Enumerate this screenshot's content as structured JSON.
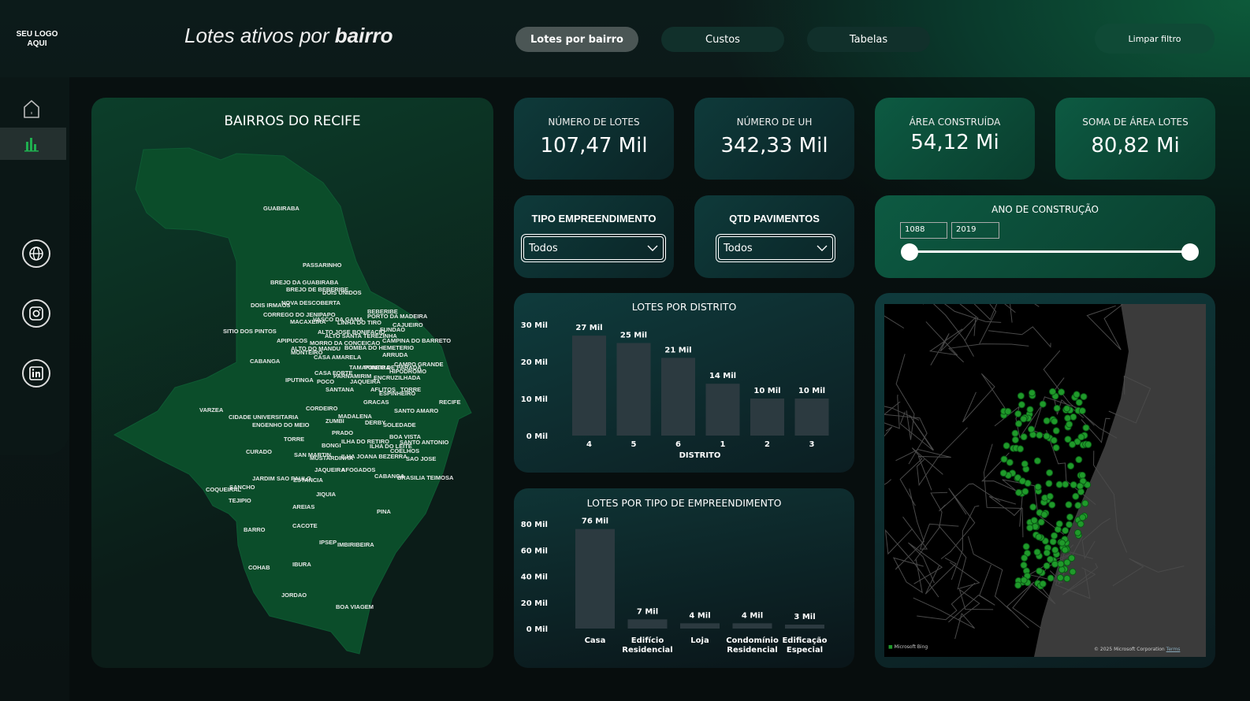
{
  "header": {
    "logo": "SEU LOGO AQUI",
    "title_prefix": "Lotes ativos por ",
    "title_bold": "bairro",
    "tabs": [
      {
        "label": "Lotes por bairro",
        "active": true
      },
      {
        "label": "Custos",
        "active": false
      },
      {
        "label": "Tabelas",
        "active": false
      }
    ],
    "clear_filter": "Limpar filtro"
  },
  "sidebar": {
    "items": [
      {
        "icon": "home-icon"
      },
      {
        "icon": "bar-chart-icon",
        "active": true
      },
      {
        "icon": "globe-icon"
      },
      {
        "icon": "instagram-icon"
      },
      {
        "icon": "linkedin-icon"
      }
    ]
  },
  "map_card": {
    "title": "BAIRROS DO RECIFE",
    "fill_color": "#0b4d2a",
    "labels": [
      "GUABIRABA",
      "PASSARINHO",
      "BREJO DA GUABIRABA",
      "BREJO DE BEBERIBE",
      "DOIS UNIDOS",
      "DOIS IRMAOS",
      "NOVA DESCOBERTA",
      "CORREGO DO JENIPAPO",
      "VASCO DA GAMA",
      "MACAXEIRA",
      "LINHA DO TIRO",
      "BEBERIBE",
      "PORTO DA MADEIRA",
      "CAJUEIRO",
      "FUNDAO",
      "SITIO DOS PINTOS",
      "ALTO JOSE BONIFACIO",
      "ALTO SANTA TEREZINHA",
      "APIPUCOS",
      "MORRO DA CONCEICAO",
      "CAMPINA DO BARRETO",
      "ALTO DO MANDU",
      "MONTEIRO",
      "CASA AMARELA",
      "BOMBA DO HEMETERIO",
      "ARRUDA",
      "CABANGA",
      "TAMARINEIRA",
      "PONTO DE PARADA",
      "CAMPO GRANDE",
      "HIPODROMO",
      "CASA FORTE",
      "PARNAMIRIM",
      "IPUTINGA",
      "POCO",
      "JAQUEIRA",
      "ENCRUZILHADA",
      "SANTANA",
      "AFLITOS",
      "TORRE",
      "ESPINHEIRO",
      "GRACAS",
      "RECIFE",
      "VARZEA",
      "CORDEIRO",
      "SANTO AMARO",
      "CIDADE UNIVERSITARIA",
      "MADALENA",
      "ENGENHO DO MEIO",
      "ZUMBI",
      "DERBY",
      "SOLEDADE",
      "TORRE",
      "PRADO",
      "BOA VISTA",
      "ILHA DO RETIRO",
      "SANTO ANTONIO",
      "BONGI",
      "ILHA DO LEITE",
      "CURADO",
      "COELHOS",
      "SAN MARTIN",
      "MUSTARDINHA",
      "ILHA JOANA BEZERRA",
      "SAO JOSE",
      "JAQUEIRA",
      "AFOGADOS",
      "CABANGA",
      "BRASILIA TEIMOSA",
      "JARDIM SAO PAULO",
      "ESTANCIA",
      "SANCHO",
      "COQUEIRAL",
      "JIQUIA",
      "TEJIPIO",
      "AREIAS",
      "PINA",
      "BARRO",
      "CACOTE",
      "IPSEP",
      "IMBIRIBEIRA",
      "COHAB",
      "IBURA",
      "JORDAO",
      "BOA VIAGEM"
    ]
  },
  "kpis": [
    {
      "label": "NÚMERO DE LOTES",
      "value": "107,47 Mil"
    },
    {
      "label": "NÚMERO DE UH",
      "value": "342,33 Mil"
    },
    {
      "label": "ÁREA CONSTRUÍDA",
      "value": "54,12 Mi"
    },
    {
      "label": "SOMA DE ÁREA LOTES",
      "value": "80,82 Mi"
    }
  ],
  "filters": {
    "tipo": {
      "title": "TIPO EMPREENDIMENTO",
      "value": "Todos"
    },
    "pavimentos": {
      "title": "QTD PAVIMENTOS",
      "value": "Todos"
    },
    "ano": {
      "title": "ANO DE CONSTRUÇÃO",
      "min": "1088",
      "max": "2019",
      "range_fraction": [
        0,
        1
      ]
    }
  },
  "chart_data": [
    {
      "type": "bar",
      "title": "LOTES POR DISTRITO",
      "xlabel": "DISTRITO",
      "ylabel": "",
      "categories": [
        "4",
        "5",
        "6",
        "1",
        "2",
        "3"
      ],
      "values": [
        27,
        25,
        21,
        14,
        10,
        10
      ],
      "data_labels": [
        "27 Mil",
        "25 Mil",
        "21 Mil",
        "14 Mil",
        "10 Mil",
        "10 Mil"
      ],
      "yticks": [
        "0 Mil",
        "10 Mil",
        "20 Mil",
        "30 Mil"
      ],
      "ylim": [
        0,
        30
      ],
      "bar_color": "#2c3a40"
    },
    {
      "type": "bar",
      "title": "LOTES POR TIPO DE EMPREENDIMENTO",
      "xlabel": "",
      "ylabel": "",
      "categories": [
        "Casa",
        "Edifício Residencial",
        "Loja",
        "Condomínio Residencial",
        "Edificação Especial"
      ],
      "values": [
        76,
        7,
        4,
        4,
        3
      ],
      "data_labels": [
        "76 Mil",
        "7 Mil",
        "4 Mil",
        "4 Mil",
        "3 Mil"
      ],
      "yticks": [
        "0 Mil",
        "20 Mil",
        "40 Mil",
        "60 Mil",
        "80 Mil"
      ],
      "ylim": [
        0,
        80
      ],
      "bar_color": "#2c3a40"
    }
  ],
  "geo_map": {
    "attribution_left": "Microsoft Bing",
    "attribution_right": "© 2025 Microsoft Corporation",
    "terms": "Terms",
    "point_color": "#1f9a2a"
  }
}
